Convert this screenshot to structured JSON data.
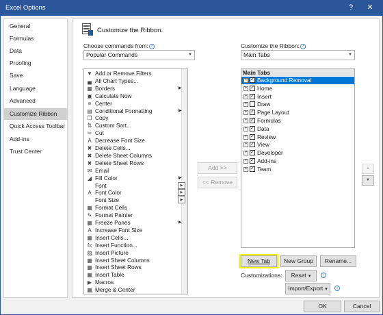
{
  "window": {
    "title": "Excel Options",
    "help_glyph": "?",
    "close_glyph": "✕"
  },
  "nav": {
    "items": [
      {
        "label": "General"
      },
      {
        "label": "Formulas"
      },
      {
        "label": "Data"
      },
      {
        "label": "Proofing"
      },
      {
        "label": "Save"
      },
      {
        "label": "Language"
      },
      {
        "label": "Advanced"
      },
      {
        "label": "Customize Ribbon",
        "selected": true
      },
      {
        "label": "Quick Access Toolbar"
      },
      {
        "label": "Add-ins"
      },
      {
        "label": "Trust Center"
      }
    ]
  },
  "header": {
    "title": "Customize the Ribbon.",
    "icon": "ribbon-customize-icon"
  },
  "left_panel": {
    "choose_label": "Choose commands from:",
    "choose_value": "Popular Commands",
    "commands": [
      {
        "label": "Add or Remove Filters",
        "icon": "filter-icon",
        "glyph": "▼"
      },
      {
        "label": "All Chart Types...",
        "icon": "chart-icon",
        "glyph": "▄"
      },
      {
        "label": "Borders",
        "icon": "borders-icon",
        "glyph": "▦",
        "marker": "sub"
      },
      {
        "label": "Calculate Now",
        "icon": "calculator-icon",
        "glyph": "▣"
      },
      {
        "label": "Center",
        "icon": "align-center-icon",
        "glyph": "≡"
      },
      {
        "label": "Conditional Formatting",
        "icon": "conditional-formatting-icon",
        "glyph": "▤",
        "marker": "sub"
      },
      {
        "label": "Copy",
        "icon": "copy-icon",
        "glyph": "❐"
      },
      {
        "label": "Custom Sort...",
        "icon": "sort-icon",
        "glyph": "⇅"
      },
      {
        "label": "Cut",
        "icon": "cut-icon",
        "glyph": "✂"
      },
      {
        "label": "Decrease Font Size",
        "icon": "decrease-font-icon",
        "glyph": "A"
      },
      {
        "label": "Delete Cells...",
        "icon": "delete-cells-icon",
        "glyph": "✖"
      },
      {
        "label": "Delete Sheet Columns",
        "icon": "delete-columns-icon",
        "glyph": "✖"
      },
      {
        "label": "Delete Sheet Rows",
        "icon": "delete-rows-icon",
        "glyph": "✖"
      },
      {
        "label": "Email",
        "icon": "email-icon",
        "glyph": "✉"
      },
      {
        "label": "Fill Color",
        "icon": "fill-color-icon",
        "glyph": "◢",
        "marker": "sub"
      },
      {
        "label": "Font",
        "icon": "",
        "glyph": "",
        "marker": "box"
      },
      {
        "label": "Font Color",
        "icon": "font-color-icon",
        "glyph": "A",
        "marker": "box"
      },
      {
        "label": "Font Size",
        "icon": "",
        "glyph": "",
        "marker": "box"
      },
      {
        "label": "Format Cells",
        "icon": "format-cells-icon",
        "glyph": "▦"
      },
      {
        "label": "Format Painter",
        "icon": "format-painter-icon",
        "glyph": "✎"
      },
      {
        "label": "Freeze Panes",
        "icon": "freeze-panes-icon",
        "glyph": "▦",
        "marker": "sub"
      },
      {
        "label": "Increase Font Size",
        "icon": "increase-font-icon",
        "glyph": "A"
      },
      {
        "label": "Insert Cells...",
        "icon": "insert-cells-icon",
        "glyph": "▦"
      },
      {
        "label": "Insert Function...",
        "icon": "insert-function-icon",
        "glyph": "fx"
      },
      {
        "label": "Insert Picture",
        "icon": "insert-picture-icon",
        "glyph": "▨"
      },
      {
        "label": "Insert Sheet Columns",
        "icon": "insert-columns-icon",
        "glyph": "▦"
      },
      {
        "label": "Insert Sheet Rows",
        "icon": "insert-rows-icon",
        "glyph": "▦"
      },
      {
        "label": "Insert Table",
        "icon": "insert-table-icon",
        "glyph": "▦"
      },
      {
        "label": "Macros",
        "icon": "macros-icon",
        "glyph": "▶"
      },
      {
        "label": "Merge & Center",
        "icon": "merge-center-icon",
        "glyph": "▦"
      }
    ]
  },
  "middle": {
    "add_label": "Add >>",
    "remove_label": "<< Remove"
  },
  "right_panel": {
    "customize_label": "Customize the Ribbon:",
    "customize_value": "Main Tabs",
    "tree_header": "Main Tabs",
    "tabs": [
      {
        "label": "Background Removal",
        "checked": true,
        "selected": true
      },
      {
        "label": "Home",
        "checked": true
      },
      {
        "label": "Insert",
        "checked": true
      },
      {
        "label": "Draw",
        "checked": false
      },
      {
        "label": "Page Layout",
        "checked": true
      },
      {
        "label": "Formulas",
        "checked": true
      },
      {
        "label": "Data",
        "checked": true
      },
      {
        "label": "Review",
        "checked": true
      },
      {
        "label": "View",
        "checked": true
      },
      {
        "label": "Developer",
        "checked": true
      },
      {
        "label": "Add-ins",
        "checked": true
      },
      {
        "label": "Team",
        "checked": true
      }
    ],
    "new_tab_label": "New Tab",
    "new_group_label": "New Group",
    "rename_label": "Rename...",
    "customizations_label": "Customizations:",
    "reset_label": "Reset",
    "import_export_label": "Import/Export"
  },
  "footer": {
    "ok_label": "OK",
    "cancel_label": "Cancel"
  },
  "colors": {
    "title_bar": "#2b579a",
    "selection": "#0078d7",
    "highlight": "#f5f000"
  }
}
